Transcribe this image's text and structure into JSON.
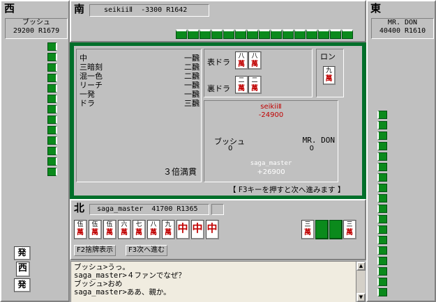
{
  "west": {
    "wind": "西",
    "name": "ブッシュ",
    "score_rank": "29200 R1679"
  },
  "south": {
    "wind": "南",
    "info": "seikiiⅡ  -3300 R1642"
  },
  "east": {
    "wind": "東",
    "name": "MR. DON",
    "score_rank": "40400 R1610"
  },
  "north": {
    "wind": "北",
    "info": "saga_master  41700 R1365"
  },
  "result": {
    "yaku": [
      {
        "name": "中",
        "han": "一飜"
      },
      {
        "name": "三暗刻",
        "han": "二飜"
      },
      {
        "name": "混一色",
        "han": "二飜"
      },
      {
        "name": "リーチ",
        "han": "一飜"
      },
      {
        "name": "一発",
        "han": "一飜"
      },
      {
        "name": "ドラ",
        "han": "三飜"
      }
    ],
    "limit": "３倍満貫",
    "omote_label": "表ドラ",
    "ura_label": "裏ドラ",
    "omote_tiles": [
      {
        "num": "八",
        "suit": "萬"
      },
      {
        "num": "八",
        "suit": "萬"
      }
    ],
    "ura_tiles": [
      {
        "num": "二",
        "suit": "萬"
      },
      {
        "num": "二",
        "suit": "萬"
      }
    ],
    "win_type": "ロン",
    "win_tile": {
      "num": "九",
      "suit": "萬"
    },
    "loser_name": "seikiiⅡ",
    "loser_delta": "-24900",
    "p_left_name": "ブッシュ",
    "p_left_delta": "0",
    "p_right_name": "MR. DON",
    "p_right_delta": "0",
    "winner_name": "saga_master",
    "winner_delta": "+26900",
    "continue_hint": "【 F3キーを押すと次へ進みます 】"
  },
  "hand": {
    "tiles": [
      {
        "num": "伍",
        "suit": "萬"
      },
      {
        "num": "伍",
        "suit": "萬"
      },
      {
        "num": "伍",
        "suit": "萬"
      },
      {
        "num": "六",
        "suit": "萬"
      },
      {
        "num": "七",
        "suit": "萬"
      },
      {
        "num": "八",
        "suit": "萬"
      },
      {
        "num": "九",
        "suit": "萬"
      },
      {
        "num": "",
        "suit": "中"
      },
      {
        "num": "",
        "suit": "中"
      },
      {
        "num": "",
        "suit": "中"
      }
    ],
    "right_tiles": [
      {
        "num": "三",
        "suit": "萬"
      },
      {
        "num": "三",
        "suit": "萬"
      }
    ]
  },
  "buttons": {
    "discards": "F2捨牌表示",
    "next": "F3次へ進む"
  },
  "west_discards": [
    "発",
    "西",
    "発"
  ],
  "chat": [
    "ブッシュ>うっ。",
    "saga_master>４ファンでなぜ？",
    "ブッシュ>おめ",
    "saga_master>ああ、親か。"
  ],
  "colors": {
    "table_green": "#006f2a",
    "red_text": "#c00000"
  }
}
